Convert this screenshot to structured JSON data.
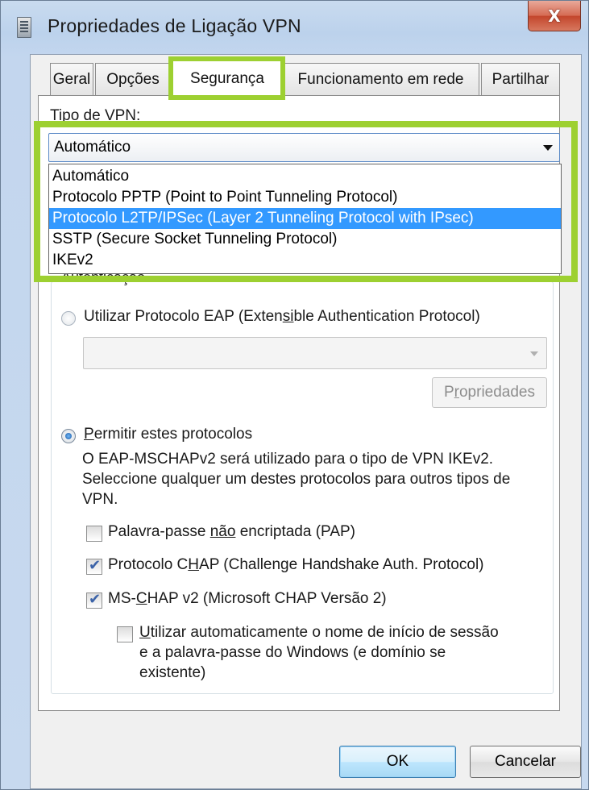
{
  "window": {
    "title": "Propriedades de Ligação VPN",
    "close_glyph": "X"
  },
  "tabs": [
    {
      "label": "Geral",
      "active": false
    },
    {
      "label": "Opções",
      "active": false
    },
    {
      "label": "Segurança",
      "active": true
    },
    {
      "label": "Funcionamento em rede",
      "active": false
    },
    {
      "label": "Partilhar",
      "active": false
    }
  ],
  "vpn_type": {
    "label": "Tipo de VPN:",
    "selected": "Automático",
    "options": [
      "Automático",
      "Protocolo PPTP (Point to Point Tunneling Protocol)",
      "Protocolo L2TP/IPSec (Layer 2 Tunneling Protocol with IPsec)",
      "SSTP (Secure Socket Tunneling Protocol)",
      "IKEv2"
    ],
    "highlighted_index": 2
  },
  "auth": {
    "group_title": "Autenticação",
    "eap_option": {
      "pre": "Utilizar Protocolo EAP (Exten",
      "accel": "si",
      "post": "ble Authentication Protocol)",
      "selected": false
    },
    "eap_properties_button": {
      "pre": "P",
      "accel": "r",
      "post": "opriedades"
    },
    "allow_option": {
      "accel": "P",
      "post": "ermitir estes protocolos",
      "selected": true
    },
    "description": "O EAP-MSCHAPv2 será utilizado para o tipo de VPN IKEv2. Seleccione qualquer um destes protocolos para outros tipos de VPN.",
    "checkboxes": {
      "pap": {
        "pre": "Palavra-passe ",
        "accel": "não",
        "post": " encriptada (PAP)",
        "checked": false
      },
      "chap": {
        "pre": "Protocolo C",
        "accel": "H",
        "post": "AP (Challenge Handshake Auth. Protocol)",
        "checked": true
      },
      "mschap": {
        "pre": "MS-",
        "accel": "C",
        "post": "HAP v2 (Microsoft CHAP Versão 2)",
        "checked": true
      },
      "autologon": {
        "accel": "U",
        "line1": "tilizar automaticamente o nome de início de sessão",
        "line2": "e a palavra-passe do Windows (e domínio se",
        "line3": "existente)",
        "checked": false
      }
    }
  },
  "buttons": {
    "ok": "OK",
    "cancel": "Cancelar"
  },
  "colors": {
    "highlight": "#9dd031",
    "selection": "#3399ff"
  }
}
